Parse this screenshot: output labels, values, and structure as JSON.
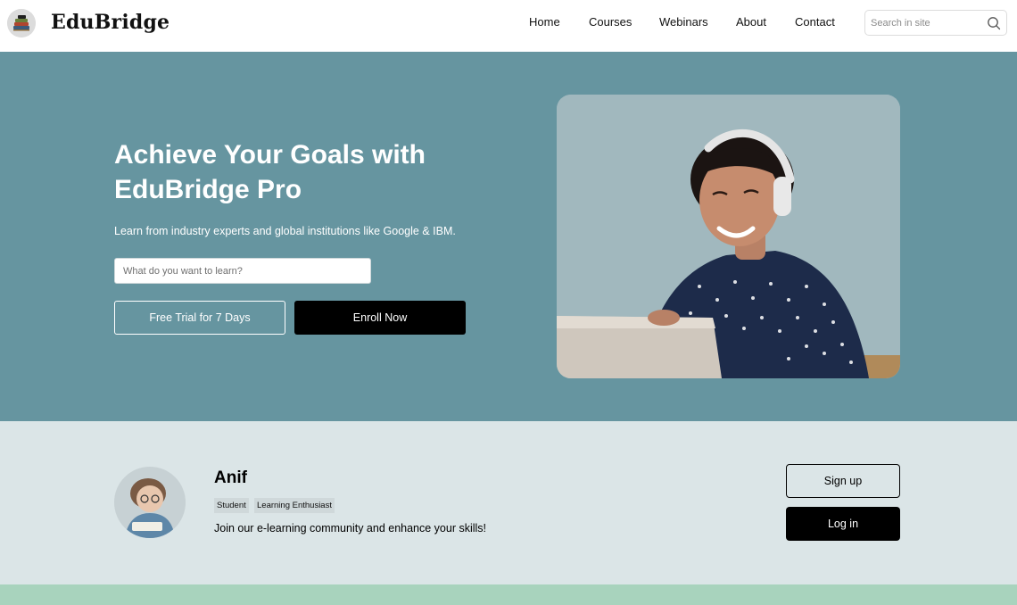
{
  "header": {
    "brand": "EduBridge",
    "logo_icon": "books-stack-logo-icon",
    "nav": [
      {
        "label": "Home"
      },
      {
        "label": "Courses"
      },
      {
        "label": "Webinars"
      },
      {
        "label": "About"
      },
      {
        "label": "Contact"
      }
    ],
    "search": {
      "placeholder": "Search in site",
      "value": "",
      "icon": "search-icon"
    }
  },
  "hero": {
    "title_line1": "Achieve Your Goals with",
    "title_line2": "EduBridge Pro",
    "subtitle": "Learn from industry experts and global institutions like Google & IBM.",
    "input_placeholder": "What do you want to learn?",
    "input_value": "",
    "trial_button": "Free Trial for 7 Days",
    "enroll_button": "Enroll Now",
    "photo": "woman-with-headphones-at-laptop-photo"
  },
  "profile": {
    "name": "Anif",
    "tags": [
      "Student",
      "Learning Enthusiast"
    ],
    "bio": "Join our e-learning community and enhance your skills!",
    "avatar": "cartoon-reader-avatar",
    "signup_button": "Sign up",
    "login_button": "Log in"
  },
  "colors": {
    "hero_bg": "#6695a0",
    "profile_bg": "#dbe5e7",
    "bottom_band": "#a8d3bd",
    "primary_button": "#000000"
  }
}
